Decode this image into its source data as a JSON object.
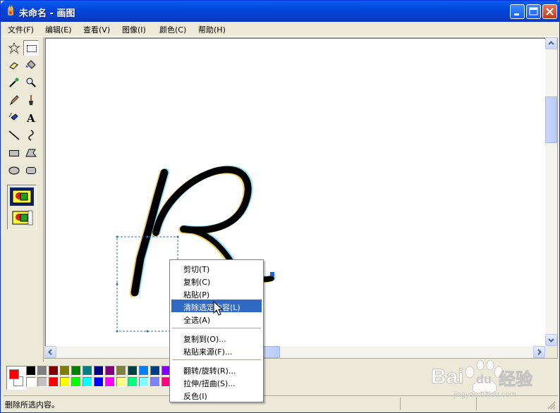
{
  "window": {
    "title": "未命名 - 画图"
  },
  "menu": [
    "文件(F)",
    "编辑(E)",
    "查看(V)",
    "图像(I)",
    "颜色(C)",
    "帮助(H)"
  ],
  "tools": [
    "free-form-select-icon",
    "select-icon",
    "eraser-icon",
    "fill-icon",
    "pick-color-icon",
    "magnifier-icon",
    "pencil-icon",
    "brush-icon",
    "airbrush-icon",
    "text-icon",
    "line-icon",
    "curve-icon",
    "rectangle-icon",
    "polygon-icon",
    "ellipse-icon",
    "rounded-rectangle-icon"
  ],
  "palette": {
    "foreground": "#ff0000",
    "background": "#ffffff",
    "row1": [
      "#000000",
      "#808080",
      "#800000",
      "#808000",
      "#008000",
      "#008080",
      "#000080",
      "#800080",
      "#808040",
      "#004040",
      "#0080ff",
      "#004080",
      "#8000ff"
    ],
    "row2": [
      "#ffffff",
      "#c0c0c0",
      "#ff0000",
      "#ffff00",
      "#00ff00",
      "#00ffff",
      "#0000ff",
      "#ff00ff",
      "#ffff80",
      "#00ff80",
      "#80ffff",
      "#8080ff",
      "#ff0080"
    ]
  },
  "context_menu": {
    "items": [
      {
        "label": "剪切(T)",
        "highlighted": false
      },
      {
        "label": "复制(C)",
        "highlighted": false
      },
      {
        "label": "粘贴(P)",
        "highlighted": false
      },
      {
        "label": "清除选定内容(L)",
        "highlighted": true
      },
      {
        "label": "全选(A)",
        "highlighted": false
      },
      {
        "label": "复制到(O)...",
        "highlighted": false
      },
      {
        "label": "粘贴来源(F)...",
        "highlighted": false
      },
      {
        "label": "翻转/旋转(R)...",
        "highlighted": false
      },
      {
        "label": "拉伸/扭曲(S)...",
        "highlighted": false
      },
      {
        "label": "反色(I)",
        "highlighted": false
      }
    ]
  },
  "status": {
    "text": "删除所选内容。"
  },
  "watermark": {
    "brand": "Bai",
    "brand2": "du",
    "cn": "经验",
    "url": "jingyan.baidu.com"
  }
}
